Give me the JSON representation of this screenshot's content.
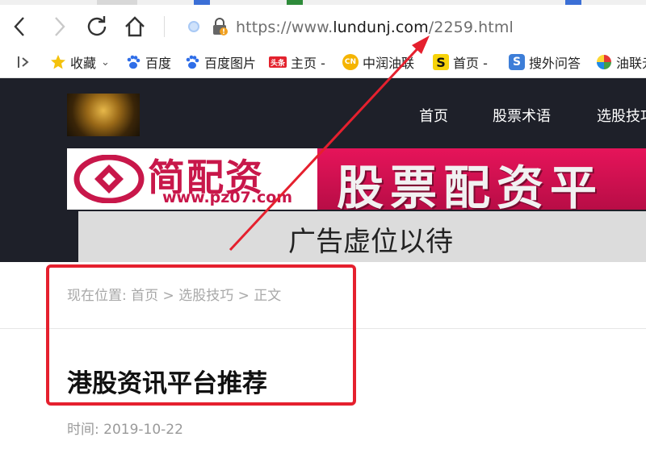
{
  "browser": {
    "url_prefix": "https://www.",
    "url_domain": "lundunj.com",
    "url_path": "/2259.html",
    "bookmarks": [
      {
        "label": "收藏",
        "icon": "star-icon"
      },
      {
        "label": "百度",
        "icon": "baidu-paw-icon"
      },
      {
        "label": "百度图片",
        "icon": "baidu-paw-icon"
      },
      {
        "label": "主页 -",
        "icon": "toutiao-icon"
      },
      {
        "label": "中润油联",
        "icon": "cn-icon"
      },
      {
        "label": "首页 -",
        "icon": "s-logo-icon"
      },
      {
        "label": "搜外问答",
        "icon": "s-square-icon"
      },
      {
        "label": "油联元",
        "icon": "pinwheel-icon"
      }
    ]
  },
  "site": {
    "nav": [
      "首页",
      "股票术语",
      "选股技巧"
    ],
    "ad_brand": "简配资",
    "ad_url": "www.pz07.com",
    "ad_slogan": "股票配资平",
    "ad_placeholder": "广告虚位以待"
  },
  "article": {
    "breadcrumb_prefix": "现在位置: ",
    "breadcrumb": [
      "首页",
      "选股技巧",
      "正文"
    ],
    "breadcrumb_sep": " > ",
    "title": "港股资讯平台推荐",
    "date_label": "时间:",
    "date": "2019-10-22"
  },
  "colors": {
    "header_bg": "#1e2029",
    "annotation_red": "#e5202e",
    "ad_magenta": "#c8174a"
  }
}
